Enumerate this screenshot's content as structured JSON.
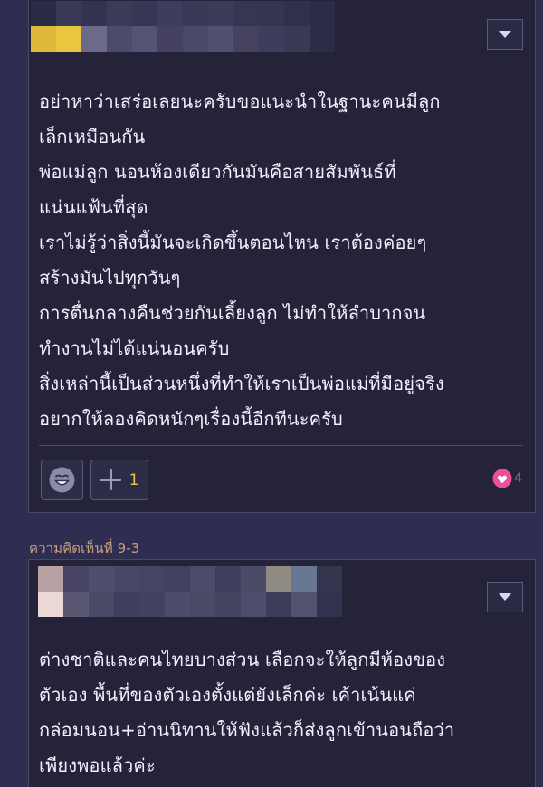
{
  "colors": {
    "background": "#2f2d50",
    "card": "#24233a",
    "text": "#f2f0ff",
    "accent": "#f0c34a",
    "comment_number": "#c6a07e",
    "muted": "#7c7a9d"
  },
  "comments": [
    {
      "author_avatar": "blurred-pixel-avatar",
      "lines": [
        "อย่าหาว่าเสร่อเลยนะครับขอแนะนำในฐานะคนมีลูก",
        "เล็กเหมือนกัน",
        "พ่อแม่ลูก นอนห้องเดียวกันมันคือสายสัมพันธ์ที่",
        "แน่นแฟ้นที่สุด",
        "เราไม่รู้ว่าสิ่งนี้มันจะเกิดขึ้นตอนไหน เราต้องค่อยๆ",
        "สร้างมันไปทุกวันๆ",
        "การตื่นกลางคืนช่วยกันเลี้ยงลูก ไม่ทำให้ลำบากจน",
        "ทำงานไม่ได้แน่นอนครับ",
        "สิ่งเหล่านี้เป็นส่วนหนึ่งที่ทำให้เราเป็นพ่อแม่ที่มีอยู่จริง",
        "อยากให้ลองคิดหนักๆเรื่องนี้อีกทีนะครับ"
      ],
      "reactions": {
        "emoji_icon": "smiley-face-icon",
        "plus_icon": "plus-icon",
        "plus_count": "1",
        "heart_icon": "heart-icon",
        "like_count": "4"
      }
    },
    {
      "number_label": "ความคิดเห็นที่ 9-3",
      "author_avatar": "blurred-pixel-avatar",
      "lines": [
        "ต่างชาติและคนไทยบางส่วน เลือกจะให้ลูกมีห้องของ",
        "ตัวเอง พื้นที่ของตัวเองตั้งแต่ยังเล็กค่ะ  เค้าเน้นแค่",
        "กล่อมนอน+อ่านนิทานให้ฟังแล้วก็ส่งลูกเข้านอนถือว่า",
        "เพียงพอแล้วค่ะ"
      ]
    }
  ]
}
